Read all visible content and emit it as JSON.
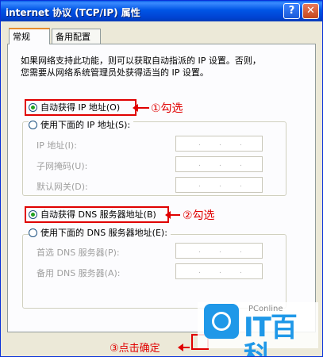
{
  "window": {
    "title": "internet 协议 (TCP/IP) 属性",
    "help_label": "?",
    "close_label": "✕"
  },
  "tabs": [
    {
      "label": "常规",
      "active": true
    },
    {
      "label": "备用配置",
      "active": false
    }
  ],
  "description": [
    "如果网络支持此功能，则可以获取自动指派的 IP 设置。否则，",
    "您需要从网络系统管理员处获得适当的 IP 设置。"
  ],
  "ip_section": {
    "auto_label": "自动获得 IP 地址(O)",
    "auto_checked": true,
    "manual_label": "使用下面的 IP 地址(S):",
    "manual_checked": false,
    "fields": [
      {
        "label": "IP 地址(I):"
      },
      {
        "label": "子网掩码(U):"
      },
      {
        "label": "默认网关(D):"
      }
    ]
  },
  "dns_section": {
    "auto_label": "自动获得 DNS 服务器地址(B)",
    "auto_checked": true,
    "manual_label": "使用下面的 DNS 服务器地址(E):",
    "manual_checked": false,
    "fields": [
      {
        "label": "首选 DNS 服务器(P):"
      },
      {
        "label": "备用 DNS 服务器(A):"
      }
    ]
  },
  "annotations": {
    "step1": "①勾选",
    "step2": "②勾选",
    "step3": "③点击确定"
  },
  "ip_dot": ".",
  "watermark": {
    "small": "PConline",
    "big": "IT百科"
  },
  "colors": {
    "accent_red": "#e00000",
    "title_blue": "#0055e5",
    "logo_blue": "#1f98e8"
  }
}
